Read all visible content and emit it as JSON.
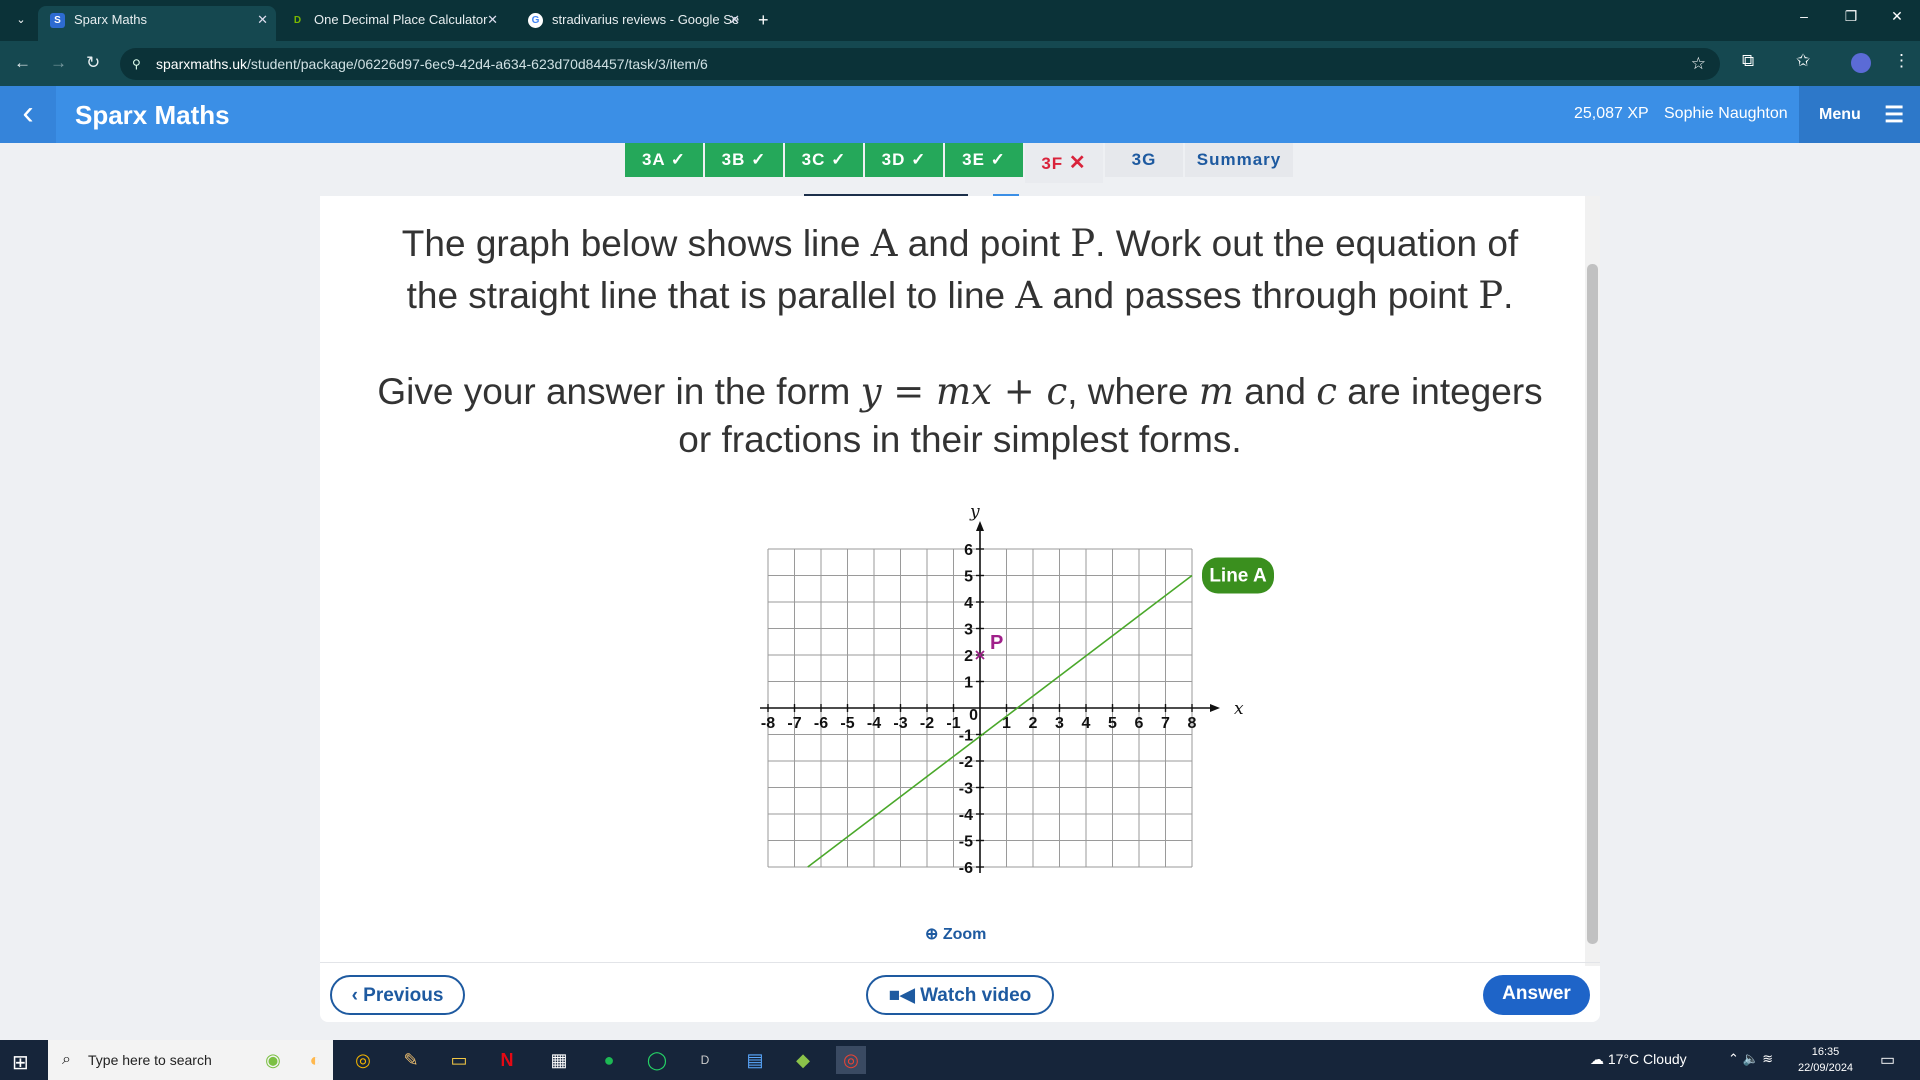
{
  "browser": {
    "tabs": [
      {
        "title": "Sparx Maths",
        "favicon": "S",
        "color": "#2d6bd1",
        "active": true
      },
      {
        "title": "One Decimal Place Calculator",
        "favicon": "D",
        "color": "#7ab800",
        "active": false
      },
      {
        "title": "stradivarius reviews - Google Se",
        "favicon": "G",
        "color": "#ffffff",
        "active": false
      }
    ],
    "url_host": "sparxmaths.uk",
    "url_path": "/student/package/06226d97-6ec9-42d4-a634-623d70d84457/task/3/item/6"
  },
  "app": {
    "title": "Sparx Maths",
    "xp": "25,087 XP",
    "user": "Sophie Naughton",
    "menu_label": "Menu"
  },
  "tasks": [
    {
      "label": "3A",
      "status": "done",
      "mark": "✓"
    },
    {
      "label": "3B",
      "status": "done",
      "mark": "✓"
    },
    {
      "label": "3C",
      "status": "done",
      "mark": "✓"
    },
    {
      "label": "3D",
      "status": "done",
      "mark": "✓"
    },
    {
      "label": "3E",
      "status": "done",
      "mark": "✓"
    },
    {
      "label": "3F",
      "status": "wrong",
      "mark": "✕"
    },
    {
      "label": "3G",
      "status": "todo",
      "mark": ""
    },
    {
      "label": "Summary",
      "status": "todo",
      "mark": ""
    }
  ],
  "question": {
    "l1a": "The graph below shows line ",
    "A": "A",
    "l1b": " and point ",
    "P": "P",
    "l1c": ". Work out the equation of",
    "l2a": "the straight line that is parallel to line ",
    "l2b": " and passes through point ",
    "l2c": ".",
    "l3a": "Give your answer in the form ",
    "eq": "y = mx + c",
    "l3b": ", where ",
    "m": "m",
    "l3c": " and ",
    "c": "c",
    "l3d": " are integers",
    "l4": "or fractions in their simplest forms."
  },
  "graph": {
    "x_axis_label": "x",
    "y_axis_label": "y",
    "origin_label": "0",
    "line_label": "Line A",
    "point_label": "P",
    "line_color": "#4aa82a",
    "point_color": "#a0208a",
    "label_bg": "#3a8f1e"
  },
  "chart_data": {
    "type": "line",
    "xlim": [
      -8,
      8
    ],
    "ylim": [
      -6,
      6
    ],
    "grid": true,
    "x_ticks": [
      -8,
      -7,
      -6,
      -5,
      -4,
      -3,
      -2,
      -1,
      1,
      2,
      3,
      4,
      5,
      6,
      7,
      8
    ],
    "y_ticks": [
      -6,
      -5,
      -4,
      -3,
      -2,
      -1,
      1,
      2,
      3,
      4,
      5,
      6
    ],
    "series": [
      {
        "name": "Line A",
        "x": [
          -6.5,
          8
        ],
        "y": [
          -6,
          5
        ],
        "slope_fraction": "3/4",
        "intercept": -1.125
      }
    ],
    "points": [
      {
        "name": "P",
        "x": 0,
        "y": 2
      }
    ]
  },
  "controls": {
    "zoom": "Zoom",
    "previous": "Previous",
    "watch_video": "Watch video",
    "answer": "Answer"
  },
  "taskbar": {
    "search_placeholder": "Type here to search",
    "weather": "17°C  Cloudy",
    "time": "16:35",
    "date": "22/09/2024"
  }
}
